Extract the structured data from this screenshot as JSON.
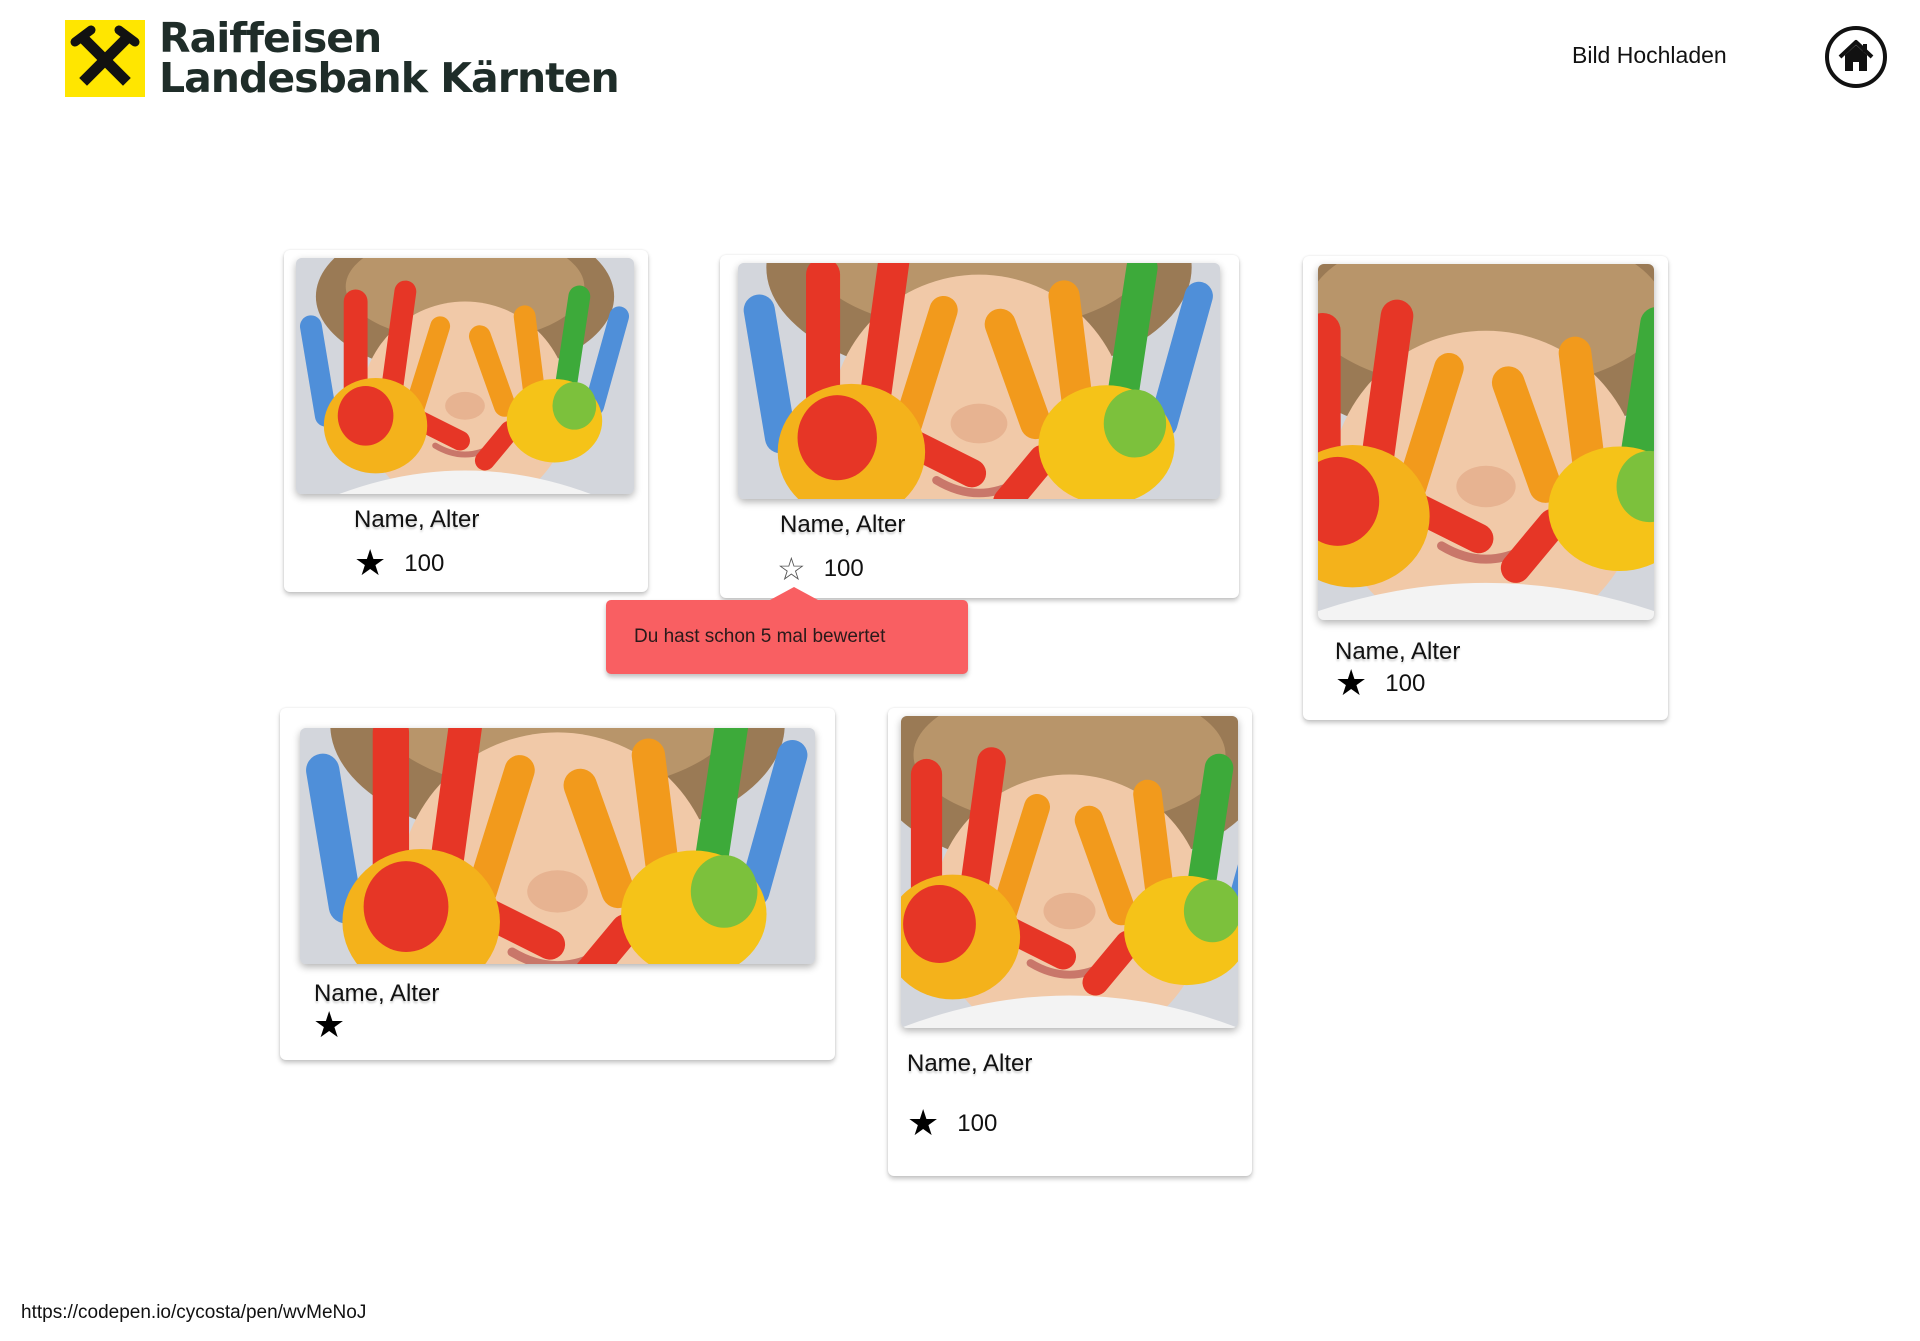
{
  "header": {
    "logo_line1": "Raiffeisen",
    "logo_line2": "Landesbank Kärnten",
    "upload_label": "Bild Hochladen",
    "home_icon": "home-icon",
    "brand_yellow": "#ffe600",
    "brand_dark": "#1f2d29"
  },
  "cards": [
    {
      "name": "Name, Alter",
      "score": "100",
      "star": "★"
    },
    {
      "name": "Name, Alter",
      "score": "100",
      "star": "☆"
    },
    {
      "name": "Name, Alter",
      "score": "100",
      "star": "★"
    },
    {
      "name": "Name, Alter",
      "star": "★"
    },
    {
      "name": "Name, Alter",
      "score": "100",
      "star": "★"
    }
  ],
  "tooltip": {
    "text": "Du hast schon 5 mal bewertet",
    "color": "#f95f62"
  },
  "footer": {
    "url": "https://codepen.io/cycosta/pen/wvMeNoJ"
  }
}
